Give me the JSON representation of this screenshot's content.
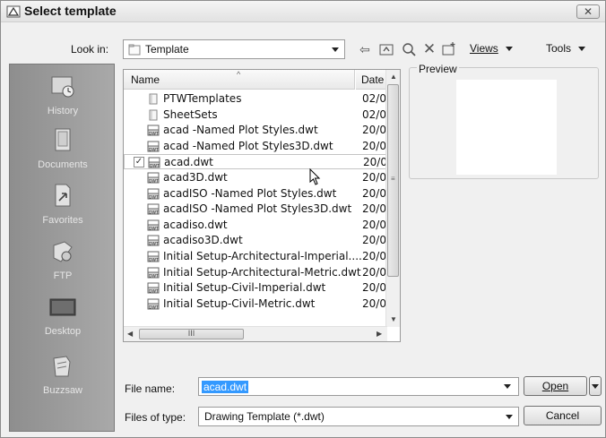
{
  "window": {
    "title": "Select template",
    "close_label": "✕"
  },
  "lookin": {
    "label": "Look in:",
    "value": "Template"
  },
  "toolbar": {
    "views_label": "Views",
    "tools_label": "Tools"
  },
  "places": [
    {
      "label": "History",
      "icon": "history-icon"
    },
    {
      "label": "Documents",
      "icon": "documents-icon"
    },
    {
      "label": "Favorites",
      "icon": "favorites-icon"
    },
    {
      "label": "FTP",
      "icon": "ftp-icon"
    },
    {
      "label": "Desktop",
      "icon": "desktop-icon"
    },
    {
      "label": "Buzzsaw",
      "icon": "buzzsaw-icon"
    }
  ],
  "filelist": {
    "columns": {
      "name": "Name",
      "date": "Date"
    },
    "files": [
      {
        "name": "PTWTemplates",
        "date": "02/0",
        "type": "folder"
      },
      {
        "name": "SheetSets",
        "date": "02/0",
        "type": "folder"
      },
      {
        "name": "acad -Named Plot Styles.dwt",
        "date": "20/0",
        "type": "dwt"
      },
      {
        "name": "acad -Named Plot Styles3D.dwt",
        "date": "20/0",
        "type": "dwt"
      },
      {
        "name": "acad.dwt",
        "date": "20/0",
        "type": "dwt"
      },
      {
        "name": "acad3D.dwt",
        "date": "20/0",
        "type": "dwt"
      },
      {
        "name": "acadISO -Named Plot Styles.dwt",
        "date": "20/0",
        "type": "dwt"
      },
      {
        "name": "acadISO -Named Plot Styles3D.dwt",
        "date": "20/0",
        "type": "dwt"
      },
      {
        "name": "acadiso.dwt",
        "date": "20/0",
        "type": "dwt"
      },
      {
        "name": "acadiso3D.dwt",
        "date": "20/0",
        "type": "dwt"
      },
      {
        "name": "Initial Setup-Architectural-Imperial....",
        "date": "20/0",
        "type": "dwt"
      },
      {
        "name": "Initial Setup-Architectural-Metric.dwt",
        "date": "20/0",
        "type": "dwt"
      },
      {
        "name": "Initial Setup-Civil-Imperial.dwt",
        "date": "20/0",
        "type": "dwt"
      },
      {
        "name": "Initial Setup-Civil-Metric.dwt",
        "date": "20/0",
        "type": "dwt"
      }
    ],
    "selected_file": "acad.dwt",
    "hscroll_grip": "III"
  },
  "preview": {
    "label": "Preview"
  },
  "filename": {
    "label": "File name:",
    "value": "acad.dwt"
  },
  "filetype": {
    "label": "Files of type:",
    "value": "Drawing Template (*.dwt)"
  },
  "buttons": {
    "open": "Open",
    "cancel": "Cancel"
  }
}
